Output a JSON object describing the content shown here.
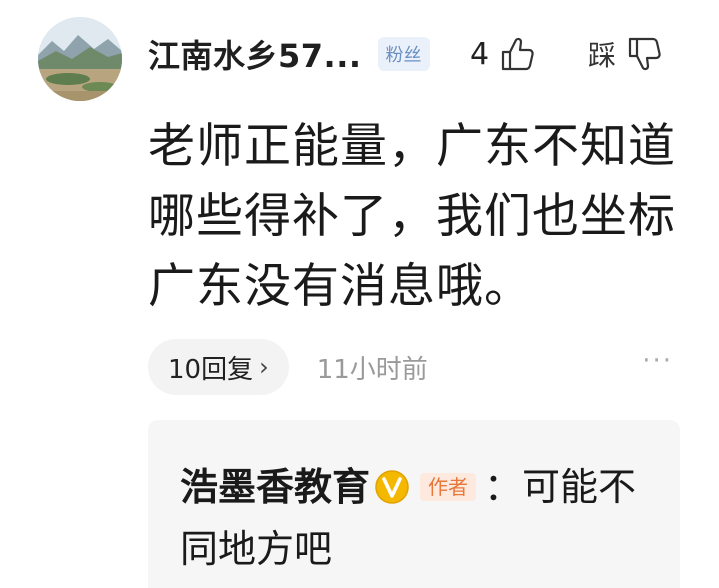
{
  "comment": {
    "username": "江南水乡57...",
    "badge": "粉丝",
    "like_count": "4",
    "dislike_label": "踩",
    "text": "老师正能量，广东不知道哪些得补了，我们也坐标广东没有消息哦。",
    "reply_label": "10回复",
    "reply_chevron": "›",
    "time": "11小时前",
    "more": "···"
  },
  "reply": {
    "author": "浩墨香教育",
    "author_tag": "作者",
    "text": "：可能不同地方吧"
  },
  "icons": {
    "avatar": "landscape-avatar",
    "like": "thumbs-up-icon",
    "dislike": "thumbs-down-icon",
    "verified": "verified-v-icon"
  },
  "colors": {
    "badge_bg": "#eaf1fb",
    "badge_text": "#6b8fc4",
    "verified": "#f5b800",
    "author_tag_text": "#e8773a",
    "author_tag_bg": "#fde9de",
    "time_text": "#9a9a9a"
  }
}
